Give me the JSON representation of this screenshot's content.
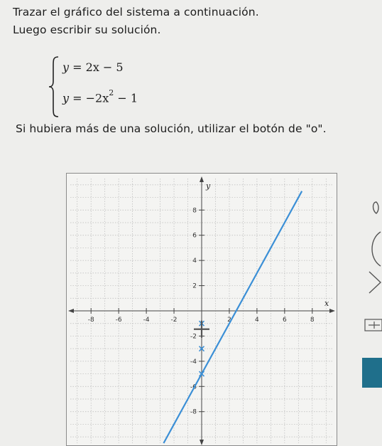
{
  "instructions": {
    "line1": "Trazar el gráfico del sistema a continuación.",
    "line2": "Luego escribir su solución.",
    "line3": "Si hubiera más de una solución, utilizar el botón de \"o\"."
  },
  "system": {
    "equation1": {
      "lhs": "y",
      "rhs": "= 2x − 5"
    },
    "equation2": {
      "lhs": "y",
      "rhs_a": "= −2x",
      "exponent": "2",
      "rhs_b": " − 1"
    }
  },
  "chart_data": {
    "type": "line",
    "xlabel": "x",
    "ylabel": "y",
    "xlim": [
      -9.5,
      9.5
    ],
    "ylim": [
      -10.5,
      10.5
    ],
    "grid": true,
    "x_ticks": [
      -8,
      -6,
      -4,
      -2,
      2,
      4,
      6,
      8
    ],
    "y_ticks": [
      8,
      6,
      4,
      2,
      -2,
      -4,
      -6,
      -8
    ],
    "tick_labels_x": [
      "-8",
      "-6",
      "-4",
      "-2",
      "2",
      "4",
      "6",
      "8"
    ],
    "tick_labels_y": [
      "8",
      "6",
      "4",
      "2",
      "-2",
      "-4",
      "-6",
      "-8"
    ],
    "series": [
      {
        "x": [
          -2.75,
          7.25
        ],
        "y": [
          -10.5,
          9.5
        ],
        "color": "#3b8fd6"
      }
    ],
    "plotted_points": [
      {
        "x": 0,
        "y": -1
      },
      {
        "x": 0,
        "y": -3
      },
      {
        "x": 0,
        "y": -5
      }
    ]
  },
  "colors": {
    "line": "#3b8fd6",
    "point": "#3b8fd6",
    "tool_active": "#1f6f8b"
  },
  "toolbar": {
    "tools": [
      {
        "name": "point-tool-icon"
      },
      {
        "name": "parabola-tool-icon"
      },
      {
        "name": "angle-tool-icon"
      },
      {
        "name": "move-tool-icon"
      },
      {
        "name": "active-tool-button"
      }
    ]
  }
}
